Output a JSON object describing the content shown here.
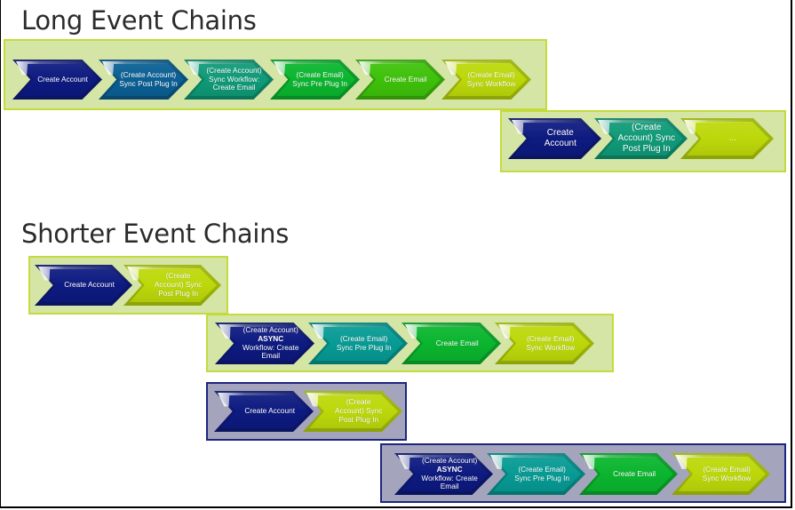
{
  "colors": {
    "navy": "#0d1a80",
    "blue_teal": "#0a5f94",
    "sea_green": "#0f9a78",
    "green": "#0ab52e",
    "bright_green": "#3ec10a",
    "yellow_green": "#bcd80a",
    "teal": "#079a94",
    "panel_green_bg": "#d5e5a6",
    "panel_green_border": "#c3db3d",
    "panel_slate_bg": "#a4a4bc",
    "panel_slate_border": "#1c2680"
  },
  "sections": [
    {
      "title": "Long Event Chains",
      "chains": [
        {
          "style": "green",
          "steps": [
            {
              "label_lines": [
                "Create Account"
              ],
              "color": "navy"
            },
            {
              "label_lines": [
                "(Create Account)",
                "Sync Post Plug In"
              ],
              "color": "blue_teal"
            },
            {
              "label_lines": [
                "(Create Account)",
                "Sync Workflow:",
                "Create Email"
              ],
              "color": "sea_green"
            },
            {
              "label_lines": [
                "(Create Email)",
                "Sync Pre Plug In"
              ],
              "color": "green"
            },
            {
              "label_lines": [
                "Create Email"
              ],
              "color": "bright_green"
            },
            {
              "label_lines": [
                "(Create Email)",
                "Sync Workflow"
              ],
              "color": "yellow_green"
            }
          ]
        },
        {
          "style": "green",
          "steps": [
            {
              "label_lines": [
                "Create",
                "Account"
              ],
              "color": "navy"
            },
            {
              "label_lines": [
                "(Create",
                "Account) Sync",
                "Post Plug In"
              ],
              "color": "sea_green"
            },
            {
              "label_lines": [
                "..."
              ],
              "color": "yellow_green"
            }
          ]
        }
      ]
    },
    {
      "title": "Shorter Event Chains",
      "chains": [
        {
          "style": "green",
          "steps": [
            {
              "label_lines": [
                "Create Account"
              ],
              "color": "navy"
            },
            {
              "label_lines": [
                "(Create",
                "Account) Sync",
                "Post Plug In"
              ],
              "color": "yellow_green"
            }
          ]
        },
        {
          "style": "green",
          "steps": [
            {
              "label_lines": [
                "(Create Account)",
                "ASYNC",
                "Workflow: Create",
                "Email"
              ],
              "bold_line": 1,
              "color": "navy"
            },
            {
              "label_lines": [
                "(Create Email)",
                "Sync Pre Plug In"
              ],
              "color": "teal"
            },
            {
              "label_lines": [
                "Create Email"
              ],
              "color": "green"
            },
            {
              "label_lines": [
                "(Create Email)",
                "Sync Workflow"
              ],
              "color": "yellow_green"
            }
          ]
        },
        {
          "style": "slate",
          "steps": [
            {
              "label_lines": [
                "Create Account"
              ],
              "color": "navy"
            },
            {
              "label_lines": [
                "(Create",
                "Account) Sync",
                "Post Plug In"
              ],
              "color": "yellow_green"
            }
          ]
        },
        {
          "style": "slate",
          "steps": [
            {
              "label_lines": [
                "(Create Account)",
                "ASYNC",
                "Workflow: Create",
                "Email"
              ],
              "bold_line": 1,
              "color": "navy"
            },
            {
              "label_lines": [
                "(Create Email)",
                "Sync Pre Plug In"
              ],
              "color": "teal"
            },
            {
              "label_lines": [
                "Create Email"
              ],
              "color": "green"
            },
            {
              "label_lines": [
                "(Create Email)",
                "Sync Workflow"
              ],
              "color": "yellow_green"
            }
          ]
        }
      ]
    }
  ]
}
